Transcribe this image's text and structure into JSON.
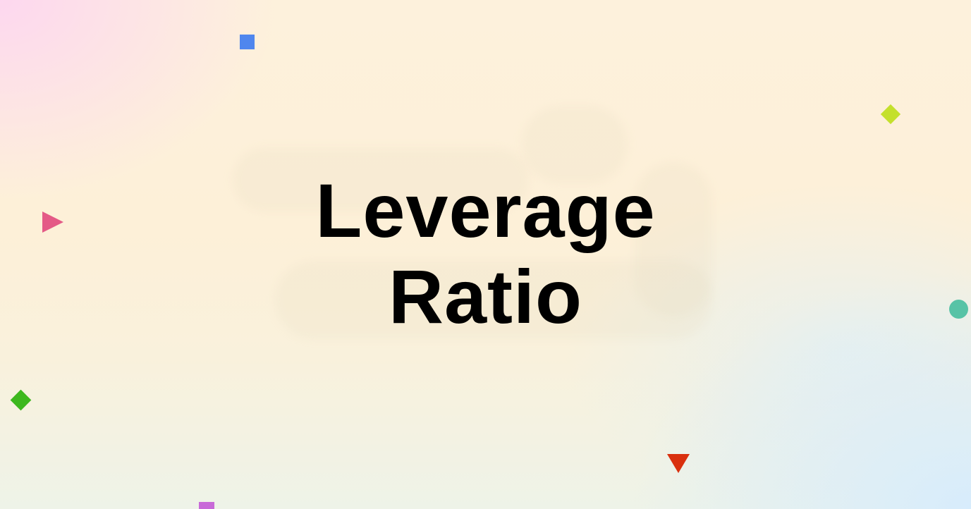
{
  "title": {
    "line1": "Leverage",
    "line2": "Ratio"
  },
  "decorations": [
    {
      "name": "blue-square",
      "color": "#4f86ee"
    },
    {
      "name": "lime-diamond",
      "color": "#c4e02c"
    },
    {
      "name": "pink-triangle",
      "color": "#e45a86"
    },
    {
      "name": "teal-circle",
      "color": "#57c3a6"
    },
    {
      "name": "green-diamond",
      "color": "#3db81e"
    },
    {
      "name": "red-triangle",
      "color": "#d9300e"
    },
    {
      "name": "purple-square",
      "color": "#c86ad8"
    }
  ]
}
